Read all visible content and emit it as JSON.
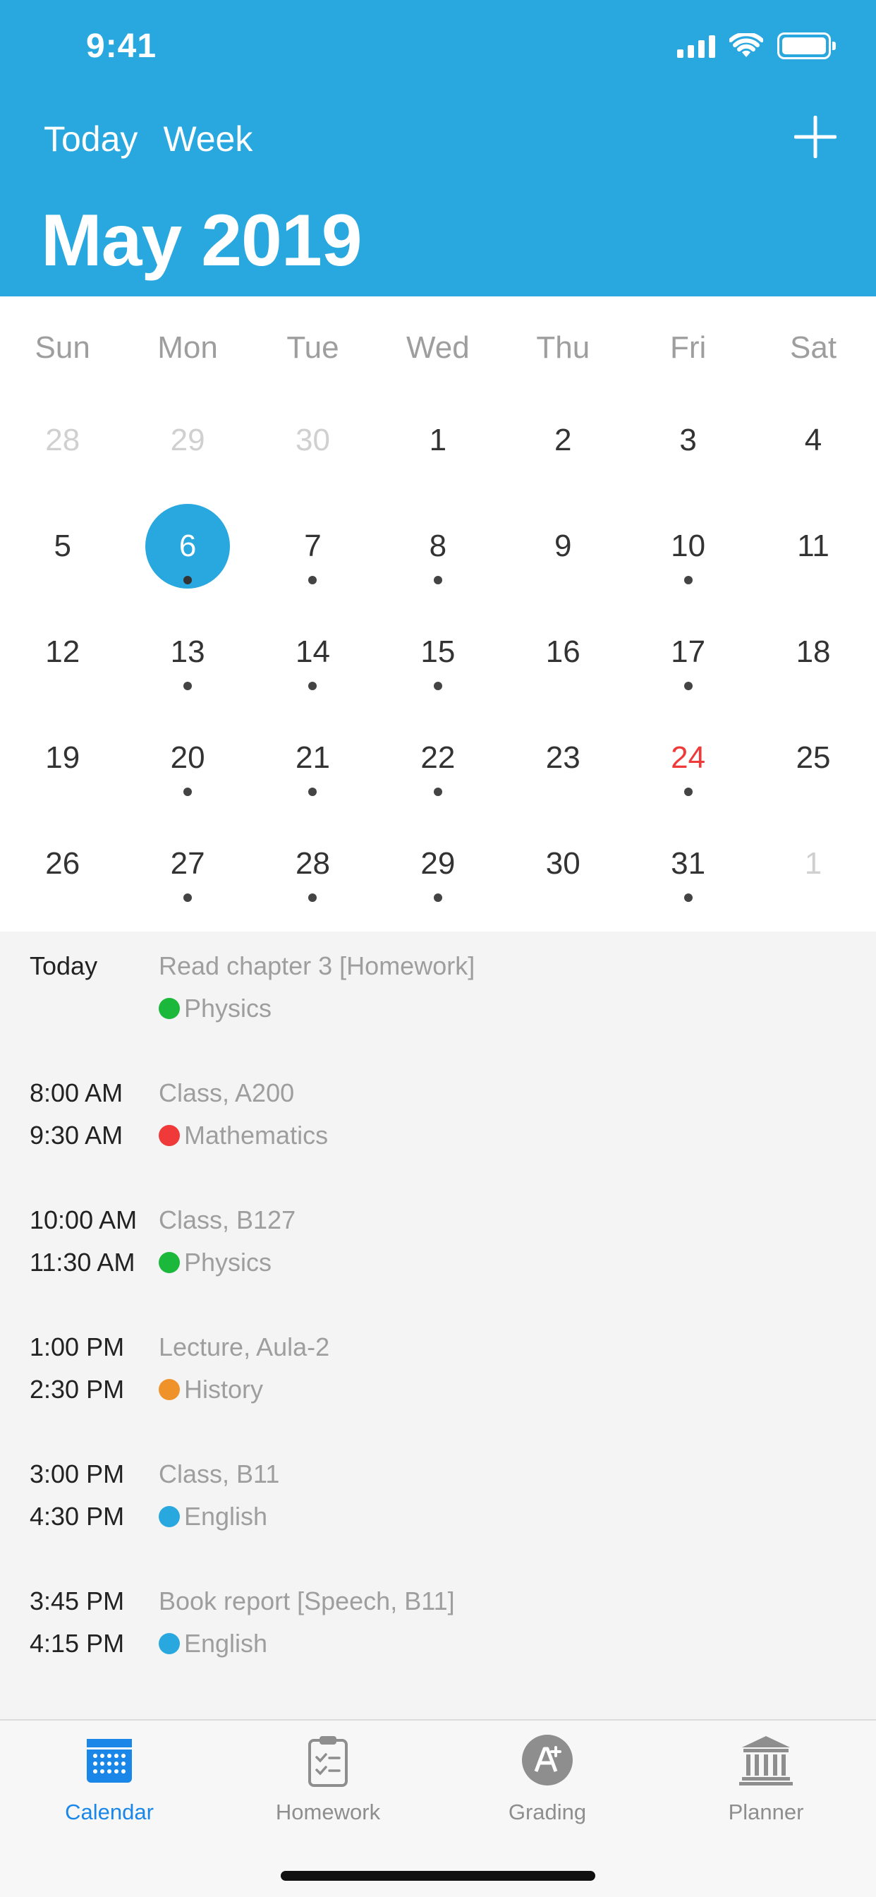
{
  "status_bar": {
    "time": "9:41"
  },
  "header": {
    "nav": [
      "Today",
      "Week"
    ],
    "month_title": "May 2019",
    "add_icon": "plus-icon"
  },
  "calendar": {
    "weekdays": [
      "Sun",
      "Mon",
      "Tue",
      "Wed",
      "Thu",
      "Fri",
      "Sat"
    ],
    "weeks": [
      [
        {
          "n": "28",
          "muted": true
        },
        {
          "n": "29",
          "muted": true
        },
        {
          "n": "30",
          "muted": true
        },
        {
          "n": "1"
        },
        {
          "n": "2"
        },
        {
          "n": "3"
        },
        {
          "n": "4"
        }
      ],
      [
        {
          "n": "5"
        },
        {
          "n": "6",
          "selected": true,
          "dot": true
        },
        {
          "n": "7",
          "dot": true
        },
        {
          "n": "8",
          "dot": true
        },
        {
          "n": "9"
        },
        {
          "n": "10",
          "dot": true
        },
        {
          "n": "11"
        }
      ],
      [
        {
          "n": "12"
        },
        {
          "n": "13",
          "dot": true
        },
        {
          "n": "14",
          "dot": true
        },
        {
          "n": "15",
          "dot": true
        },
        {
          "n": "16"
        },
        {
          "n": "17",
          "dot": true
        },
        {
          "n": "18"
        }
      ],
      [
        {
          "n": "19"
        },
        {
          "n": "20",
          "dot": true
        },
        {
          "n": "21",
          "dot": true
        },
        {
          "n": "22",
          "dot": true
        },
        {
          "n": "23"
        },
        {
          "n": "24",
          "red": true,
          "dot": true
        },
        {
          "n": "25"
        }
      ],
      [
        {
          "n": "26"
        },
        {
          "n": "27",
          "dot": true
        },
        {
          "n": "28",
          "dot": true
        },
        {
          "n": "29",
          "dot": true
        },
        {
          "n": "30"
        },
        {
          "n": "31",
          "dot": true
        },
        {
          "n": "1",
          "muted": true
        }
      ]
    ],
    "selected_color": "#29a8e0",
    "highlight_color": "#f03a3a"
  },
  "agenda": [
    {
      "time1": "Today",
      "time2": "",
      "title": "Read chapter 3 [Homework]",
      "subject": "Physics",
      "color": "#1cb83c"
    },
    {
      "time1": "8:00 AM",
      "time2": "9:30 AM",
      "title": "Class, A200",
      "subject": "Mathematics",
      "color": "#f03a3a"
    },
    {
      "time1": "10:00 AM",
      "time2": "11:30 AM",
      "title": "Class, B127",
      "subject": "Physics",
      "color": "#1cb83c"
    },
    {
      "time1": "1:00 PM",
      "time2": "2:30 PM",
      "title": "Lecture, Aula-2",
      "subject": "History",
      "color": "#f0922a"
    },
    {
      "time1": "3:00 PM",
      "time2": "4:30 PM",
      "title": "Class, B11",
      "subject": "English",
      "color": "#29a8e0"
    },
    {
      "time1": "3:45 PM",
      "time2": "4:15 PM",
      "title": "Book report [Speech, B11]",
      "subject": "English",
      "color": "#29a8e0"
    }
  ],
  "tabbar": {
    "tabs": [
      {
        "label": "Calendar",
        "icon": "calendar-icon",
        "active": true
      },
      {
        "label": "Homework",
        "icon": "clipboard-icon",
        "active": false
      },
      {
        "label": "Grading",
        "icon": "grade-icon",
        "active": false
      },
      {
        "label": "Planner",
        "icon": "institution-icon",
        "active": false
      }
    ],
    "active_color": "#1a87e8",
    "inactive_color": "#8e8e8e"
  }
}
